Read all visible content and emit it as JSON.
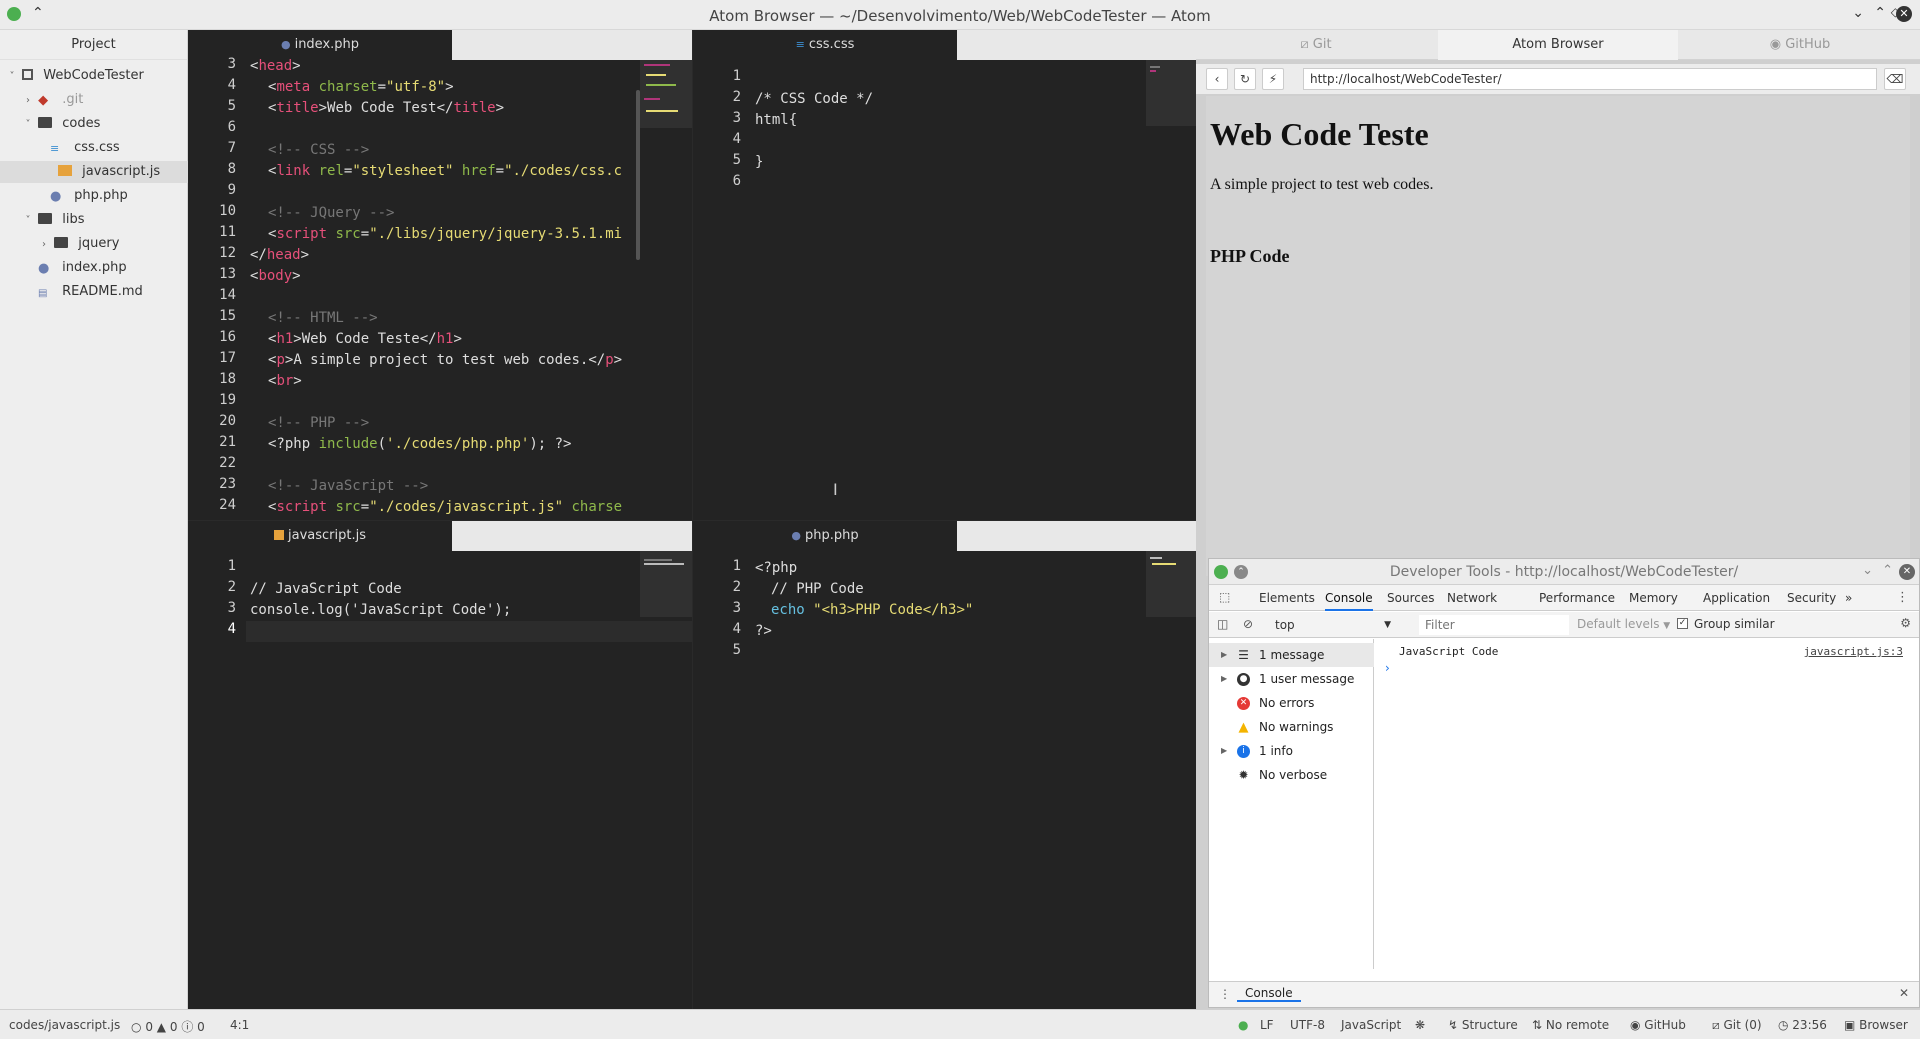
{
  "window": {
    "title": "Atom Browser — ~/Desenvolvimento/Web/WebCodeTester — Atom",
    "controls": [
      "chevron-down",
      "chevron-up",
      "diamond",
      "close"
    ]
  },
  "tree": {
    "header": "Project",
    "items": [
      {
        "label": "WebCodeTester",
        "type": "repo",
        "chevron": "˅"
      },
      {
        "label": ".git",
        "type": "git",
        "chevron": "›"
      },
      {
        "label": "codes",
        "type": "folder",
        "chevron": "˅"
      },
      {
        "label": "css.css",
        "type": "css",
        "chevron": ""
      },
      {
        "label": "javascript.js",
        "type": "js",
        "chevron": ""
      },
      {
        "label": "php.php",
        "type": "php",
        "chevron": ""
      },
      {
        "label": "libs",
        "type": "folder",
        "chevron": "˅"
      },
      {
        "label": "jquery",
        "type": "folder",
        "chevron": "›"
      },
      {
        "label": "index.php",
        "type": "php",
        "chevron": ""
      },
      {
        "label": "README.md",
        "type": "md",
        "chevron": ""
      }
    ]
  },
  "editors": {
    "index": {
      "tab": "index.php",
      "line_numbers": [
        "3",
        "4",
        "5",
        "6",
        "7",
        "8",
        "9",
        "10",
        "11",
        "12",
        "13",
        "14",
        "15",
        "16",
        "17",
        "18",
        "19",
        "20",
        "21",
        "22",
        "23",
        "24"
      ]
    },
    "css": {
      "tab": "css.css",
      "line_numbers": [
        "1",
        "2",
        "3",
        "4",
        "5",
        "6"
      ],
      "lines": [
        "",
        "/* CSS Code */",
        "html{",
        "",
        "}",
        ""
      ]
    },
    "js": {
      "tab": "javascript.js",
      "line_numbers": [
        "1",
        "2",
        "3",
        "4"
      ],
      "lines": [
        "",
        "// JavaScript Code",
        "console.log('JavaScript Code');",
        ""
      ]
    },
    "php": {
      "tab": "php.php",
      "line_numbers": [
        "1",
        "2",
        "3",
        "4",
        "5"
      ]
    }
  },
  "browser": {
    "tabs": [
      "Git",
      "Atom Browser",
      "GitHub"
    ],
    "url": "http://localhost/WebCodeTester/",
    "page": {
      "h1": "Web Code Teste",
      "p": "A simple project to test web codes.",
      "h3": "PHP Code"
    }
  },
  "devtools": {
    "title": "Developer Tools - http://localhost/WebCodeTester/",
    "tabs": [
      "Elements",
      "Console",
      "Sources",
      "Network",
      "Performance",
      "Memory",
      "Application",
      "Security",
      "»"
    ],
    "context": "top",
    "filter_placeholder": "Filter",
    "levels": "Default levels",
    "group_similar": "Group similar",
    "sidebar": [
      {
        "label": "1 message",
        "icon": "list-icon",
        "arrow": true
      },
      {
        "label": "1 user message",
        "icon": "user-icon",
        "arrow": true
      },
      {
        "label": "No errors",
        "icon": "error-icon",
        "arrow": false
      },
      {
        "label": "No warnings",
        "icon": "warning-icon",
        "arrow": false
      },
      {
        "label": "1 info",
        "icon": "info-icon",
        "arrow": true
      },
      {
        "label": "No verbose",
        "icon": "bug-icon",
        "arrow": false
      }
    ],
    "console_message": "JavaScript Code",
    "console_source": "javascript.js:3",
    "drawer_tab": "Console"
  },
  "statusbar": {
    "file": "codes/javascript.js",
    "diagnostics": "0",
    "warnings": "0",
    "infos": "0",
    "cursor": "4:1",
    "line_ending": "LF",
    "encoding": "UTF-8",
    "grammar": "JavaScript",
    "structure": "Structure",
    "remote": "No remote",
    "github": "GitHub",
    "git": "Git (0)",
    "time": "23:56",
    "browser": "Browser"
  },
  "colors": {
    "tag": "#e6507a",
    "attr": "#8fb94b",
    "string": "#e6db74",
    "comment": "#777777",
    "accent": "#1a73e8"
  }
}
